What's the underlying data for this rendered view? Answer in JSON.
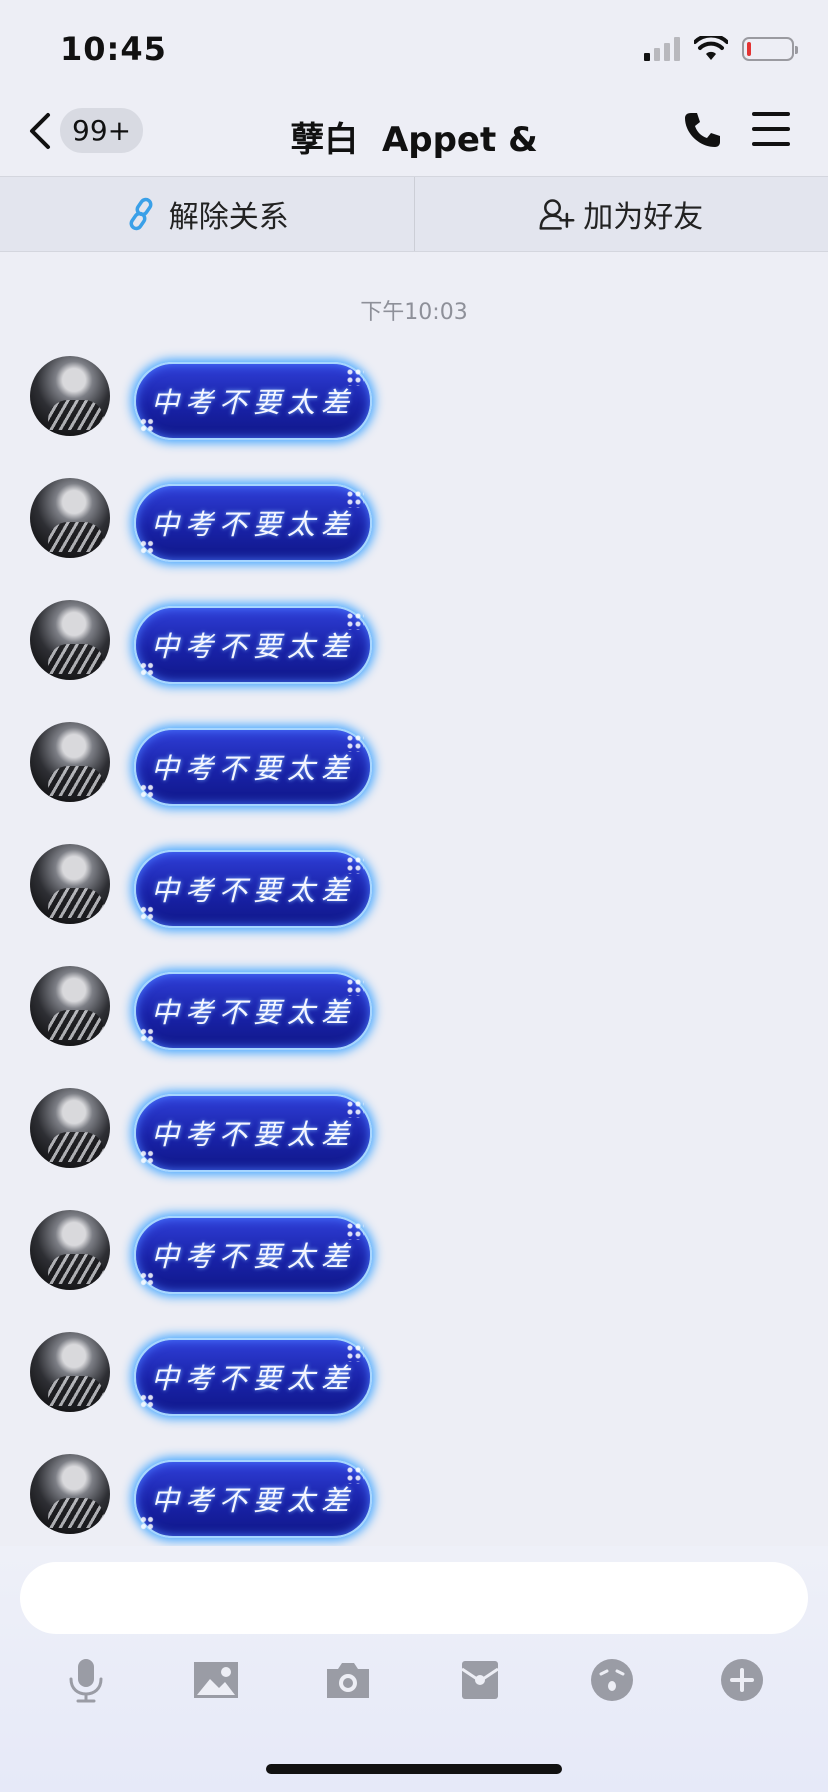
{
  "status_bar": {
    "time": "10:45",
    "signal_bars_active": 1,
    "signal_bars_total": 4,
    "battery_level": 0.1,
    "battery_color": "#e33333"
  },
  "nav": {
    "back_icon": "chevron-left-icon",
    "unread_badge": "99+",
    "title": "孽白  Appet &",
    "call_icon": "phone-icon",
    "menu_icon": "hamburger-menu-icon"
  },
  "actions": [
    {
      "label": "解除关系",
      "icon": "link-break-icon",
      "color": "#3aa0e8"
    },
    {
      "label": "加为好友",
      "icon": "add-friend-icon",
      "color": "#222222"
    }
  ],
  "timestamp": "下午10:03",
  "messages": [
    {
      "text": "中考不要太差"
    },
    {
      "text": "中考不要太差"
    },
    {
      "text": "中考不要太差"
    },
    {
      "text": "中考不要太差"
    },
    {
      "text": "中考不要太差"
    },
    {
      "text": "中考不要太差"
    },
    {
      "text": "中考不要太差"
    },
    {
      "text": "中考不要太差"
    },
    {
      "text": "中考不要太差"
    },
    {
      "text": "中考不要太差"
    }
  ],
  "input": {
    "value": "",
    "placeholder": ""
  },
  "toolbar": [
    {
      "icon": "microphone-icon"
    },
    {
      "icon": "image-icon"
    },
    {
      "icon": "camera-icon"
    },
    {
      "icon": "red-packet-icon"
    },
    {
      "icon": "emoji-icon"
    },
    {
      "icon": "plus-icon"
    }
  ],
  "colors": {
    "background": "#edeef5",
    "bubble": "#1922a8",
    "bubble_glow": "#4aa9ff",
    "icon_gray": "#9a9ca5"
  }
}
